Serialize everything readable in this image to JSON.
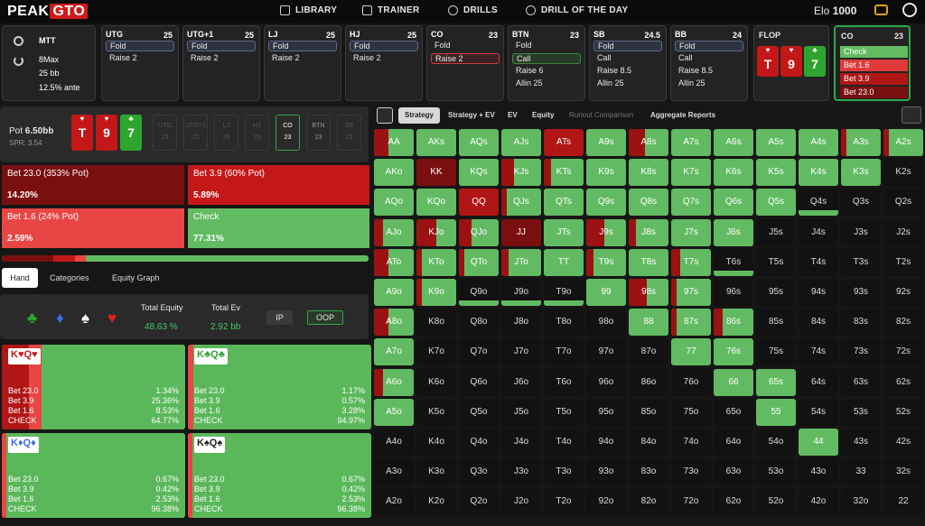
{
  "brand": {
    "peak": "PEAK",
    "gto": "GTO"
  },
  "nav": [
    {
      "label": "LIBRARY",
      "icon": "library-icon"
    },
    {
      "label": "TRAINER",
      "icon": "gamepad-icon"
    },
    {
      "label": "DRILLS",
      "icon": "drills-icon"
    },
    {
      "label": "DRILL OF THE DAY",
      "icon": "plus-circle-icon"
    }
  ],
  "user": {
    "elo_label": "Elo",
    "elo_value": "1000"
  },
  "game": {
    "type": "MTT",
    "players": "8Max",
    "stack": "25 bb",
    "ante": "12.5% ante"
  },
  "seats": [
    {
      "pos": "UTG",
      "stack": "25",
      "actions": [
        "Fold",
        "Raise 2"
      ]
    },
    {
      "pos": "UTG+1",
      "stack": "25",
      "actions": [
        "Fold",
        "Raise 2"
      ]
    },
    {
      "pos": "LJ",
      "stack": "25",
      "actions": [
        "Fold",
        "Raise 2"
      ]
    },
    {
      "pos": "HJ",
      "stack": "25",
      "actions": [
        "Fold",
        "Raise 2"
      ]
    },
    {
      "pos": "CO",
      "stack": "23",
      "actions": [
        "Fold",
        "Raise 2"
      ]
    },
    {
      "pos": "BTN",
      "stack": "23",
      "actions": [
        "Fold",
        "Call",
        "Raise 6",
        "Allin 25"
      ]
    },
    {
      "pos": "SB",
      "stack": "24.5",
      "actions": [
        "Fold",
        "Call",
        "Raise 8.5",
        "Allin 25"
      ]
    },
    {
      "pos": "BB",
      "stack": "24",
      "actions": [
        "Fold",
        "Call",
        "Raise 8.5",
        "Allin 25"
      ]
    }
  ],
  "flop": {
    "label": "FLOP",
    "cards": [
      {
        "rank": "T",
        "suit": "♥"
      },
      {
        "rank": "9",
        "suit": "♥"
      },
      {
        "rank": "7",
        "suit": "♣"
      }
    ]
  },
  "current": {
    "pos": "CO",
    "stack": "23",
    "options": [
      "Check",
      "Bet 1.6",
      "Bet 3.9",
      "Bet 23.0"
    ]
  },
  "pot": {
    "label": "Pot",
    "value": "6.50bb",
    "spr": "SPR: 3.54"
  },
  "mini_seats": [
    {
      "pos": "UTG",
      "stack": "25"
    },
    {
      "pos": "UTG+1",
      "stack": "25"
    },
    {
      "pos": "LJ",
      "stack": "25"
    },
    {
      "pos": "HJ",
      "stack": "25"
    },
    {
      "pos": "CO",
      "stack": "23"
    },
    {
      "pos": "BTN",
      "stack": "23"
    },
    {
      "pos": "SB",
      "stack": "25"
    }
  ],
  "strategy": [
    {
      "label": "Bet 23.0 (353% Pot)",
      "value": "14.20%"
    },
    {
      "label": "Bet 3.9 (60% Pot)",
      "value": "5.89%"
    },
    {
      "label": "Bet 1.6 (24% Pot)",
      "value": "2.59%"
    },
    {
      "label": "Check",
      "value": "77.31%"
    }
  ],
  "tabs": [
    "Hand",
    "Categories",
    "Equity Graph"
  ],
  "equity": {
    "total_equity_label": "Total Equity",
    "total_equity": "48.63 %",
    "total_ev_label": "Total Ev",
    "total_ev": "2.92 bb",
    "ip": "IP",
    "oop": "OOP"
  },
  "suits": [
    "♣",
    "♦",
    "♠",
    "♥"
  ],
  "hands": [
    {
      "label": "K♥Q♥",
      "rows": [
        [
          "Bet 23.0",
          "1.34%"
        ],
        [
          "Bet 3.9",
          "25.36%"
        ],
        [
          "Bet 1.6",
          "8.53%"
        ],
        [
          "CHECK",
          "64.77%"
        ]
      ]
    },
    {
      "label": "K♣Q♣",
      "rows": [
        [
          "Bet 23.0",
          "1.17%"
        ],
        [
          "Bet 3.9",
          "0.57%"
        ],
        [
          "Bet 1.6",
          "3.28%"
        ],
        [
          "CHECK",
          "94.97%"
        ]
      ]
    },
    {
      "label": "K♦Q♦",
      "rows": [
        [
          "Bet 23.0",
          "0.67%"
        ],
        [
          "Bet 3.9",
          "0.42%"
        ],
        [
          "Bet 1.6",
          "2.53%"
        ],
        [
          "CHECK",
          "96.38%"
        ]
      ]
    },
    {
      "label": "K♠Q♠",
      "rows": [
        [
          "Bet 23.0",
          "0.67%"
        ],
        [
          "Bet 3.9",
          "0.42%"
        ],
        [
          "Bet 1.6",
          "2.53%"
        ],
        [
          "CHECK",
          "96.38%"
        ]
      ]
    }
  ],
  "toolbar": [
    "Strategy",
    "Strategy + EV",
    "EV",
    "Equity",
    "Runout Comparison",
    "Aggregate Reports"
  ],
  "ranks": [
    "A",
    "K",
    "Q",
    "J",
    "T",
    "9",
    "8",
    "7",
    "6",
    "5",
    "4",
    "3",
    "2"
  ],
  "colors": {
    "check": "#62bb62",
    "bet_small": "#e03b3b",
    "bet_mid": "#c41818",
    "bet_big": "#7a0f0f",
    "accent": "#2fa84a"
  }
}
